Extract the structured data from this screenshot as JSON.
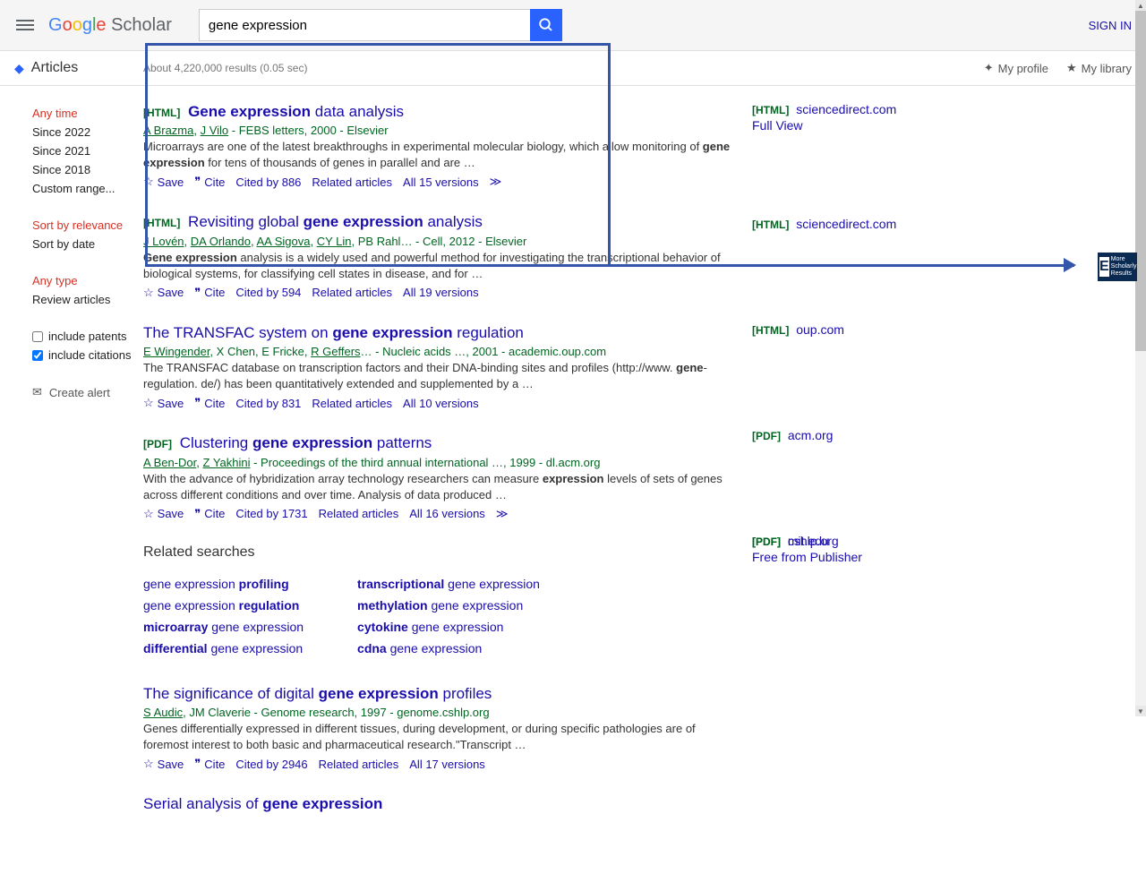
{
  "header": {
    "search_value": "gene expression",
    "signin": "SIGN IN"
  },
  "subheader": {
    "articles": "Articles",
    "stats": "About 4,220,000 results (0.05 sec)",
    "my_profile": "My profile",
    "my_library": "My library"
  },
  "sidebar": {
    "time": {
      "any": "Any time",
      "since2022": "Since 2022",
      "since2021": "Since 2021",
      "since2018": "Since 2018",
      "custom": "Custom range..."
    },
    "sort": {
      "relevance": "Sort by relevance",
      "date": "Sort by date"
    },
    "type": {
      "any": "Any type",
      "review": "Review articles"
    },
    "patents": "include patents",
    "citations": "include citations",
    "alert": "Create alert"
  },
  "results": [
    {
      "tag": "[HTML]",
      "title_pre": "",
      "title_bold": "Gene expression",
      "title_post": " data analysis",
      "authors_html": "<span class='auth'>A Brazma</span>, <span class='auth'>J Vilo</span> - FEBS letters, 2000 - Elsevier",
      "snippet_html": "Microarrays are one of the latest breakthroughs in experimental molecular biology, which allow monitoring of <b>gene expression</b> for tens of thousands of genes in parallel and are …",
      "save": "Save",
      "cite": "Cite",
      "cited": "Cited by 886",
      "related": "Related articles",
      "versions": "All 15 versions",
      "more": "≫",
      "access_tag": "[HTML]",
      "access": "sciencedirect.com",
      "access_sub": "Full View"
    },
    {
      "tag": "[HTML]",
      "title_pre": "Revisiting global ",
      "title_bold": "gene expression",
      "title_post": " analysis",
      "authors_html": "<span class='auth'>J Lovén</span>, <span class='auth'>DA Orlando</span>, <span class='auth'>AA Sigova</span>, <span class='auth'>CY Lin</span>, PB Rahl… - Cell, 2012 - Elsevier",
      "snippet_html": "<b>Gene expression</b> analysis is a widely used and powerful method for investigating the transcriptional behavior of biological systems, for classifying cell states in disease, and for …",
      "save": "Save",
      "cite": "Cite",
      "cited": "Cited by 594",
      "related": "Related articles",
      "versions": "All 19 versions",
      "more": "",
      "access_tag": "[HTML]",
      "access": "sciencedirect.com",
      "access_sub": ""
    },
    {
      "tag": "",
      "title_pre": "The TRANSFAC system on ",
      "title_bold": "gene expression",
      "title_post": " regulation",
      "authors_html": "<span class='auth'>E Wingender</span>, X Chen, E Fricke, <span class='auth'>R Geffers</span>… - Nucleic acids …, 2001 - academic.oup.com",
      "snippet_html": "The TRANSFAC database on transcription factors and their DNA-binding sites and profiles (http://www. <b>gene</b>-regulation. de/) has been quantitatively extended and supplemented by a …",
      "save": "Save",
      "cite": "Cite",
      "cited": "Cited by 831",
      "related": "Related articles",
      "versions": "All 10 versions",
      "more": "",
      "access_tag": "[HTML]",
      "access": "oup.com",
      "access_sub": ""
    },
    {
      "tag": "[PDF]",
      "title_pre": "Clustering ",
      "title_bold": "gene expression",
      "title_post": " patterns",
      "authors_html": "<span class='auth'>A Ben-Dor</span>, <span class='auth'>Z Yakhini</span> - Proceedings of the third annual international …, 1999 - dl.acm.org",
      "snippet_html": "With the advance of hybridization array technology researchers can measure <b>expression</b> levels of sets of genes across different conditions and over time. Analysis of data produced …",
      "save": "Save",
      "cite": "Cite",
      "cited": "Cited by 1731",
      "related": "Related articles",
      "versions": "All 16 versions",
      "more": "≫",
      "access_tag": "[PDF]",
      "access": "acm.org",
      "access_sub": ""
    },
    {
      "tag": "",
      "title_pre": "The significance of digital ",
      "title_bold": "gene expression",
      "title_post": " profiles",
      "authors_html": "<span class='auth'>S Audic</span>, JM Claverie - Genome research, 1997 - genome.cshlp.org",
      "snippet_html": "Genes differentially expressed in different tissues, during development, or during specific pathologies are of foremost interest to both basic and pharmaceutical research.\"Transcript …",
      "save": "Save",
      "cite": "Cite",
      "cited": "Cited by 2946",
      "related": "Related articles",
      "versions": "All 17 versions",
      "more": "",
      "access_tag": "[PDF]",
      "access": "cshlp.org",
      "access_sub": "Free from Publisher"
    },
    {
      "tag": "",
      "title_pre": "Serial analysis of ",
      "title_bold": "gene expression",
      "title_post": "",
      "authors_html": "",
      "snippet_html": "",
      "save": "",
      "cite": "",
      "cited": "",
      "related": "",
      "versions": "",
      "more": "",
      "access_tag": "[PDF]",
      "access": "mit.edu",
      "access_sub": ""
    }
  ],
  "related": {
    "heading": "Related searches",
    "left": [
      {
        "pre": "gene expression ",
        "bold": "profiling",
        "post": ""
      },
      {
        "pre": "gene expression ",
        "bold": "regulation",
        "post": ""
      },
      {
        "pre": "",
        "bold": "microarray",
        "post": " gene expression"
      },
      {
        "pre": "",
        "bold": "differential",
        "post": " gene expression"
      }
    ],
    "right": [
      {
        "pre": "",
        "bold": "transcriptional",
        "post": " gene expression"
      },
      {
        "pre": "",
        "bold": "methylation",
        "post": " gene expression"
      },
      {
        "pre": "",
        "bold": "cytokine",
        "post": " gene expression"
      },
      {
        "pre": "",
        "bold": "cdna",
        "post": " gene expression"
      }
    ]
  },
  "ext": {
    "E": "E",
    "txt": "More Scholarly Results"
  }
}
